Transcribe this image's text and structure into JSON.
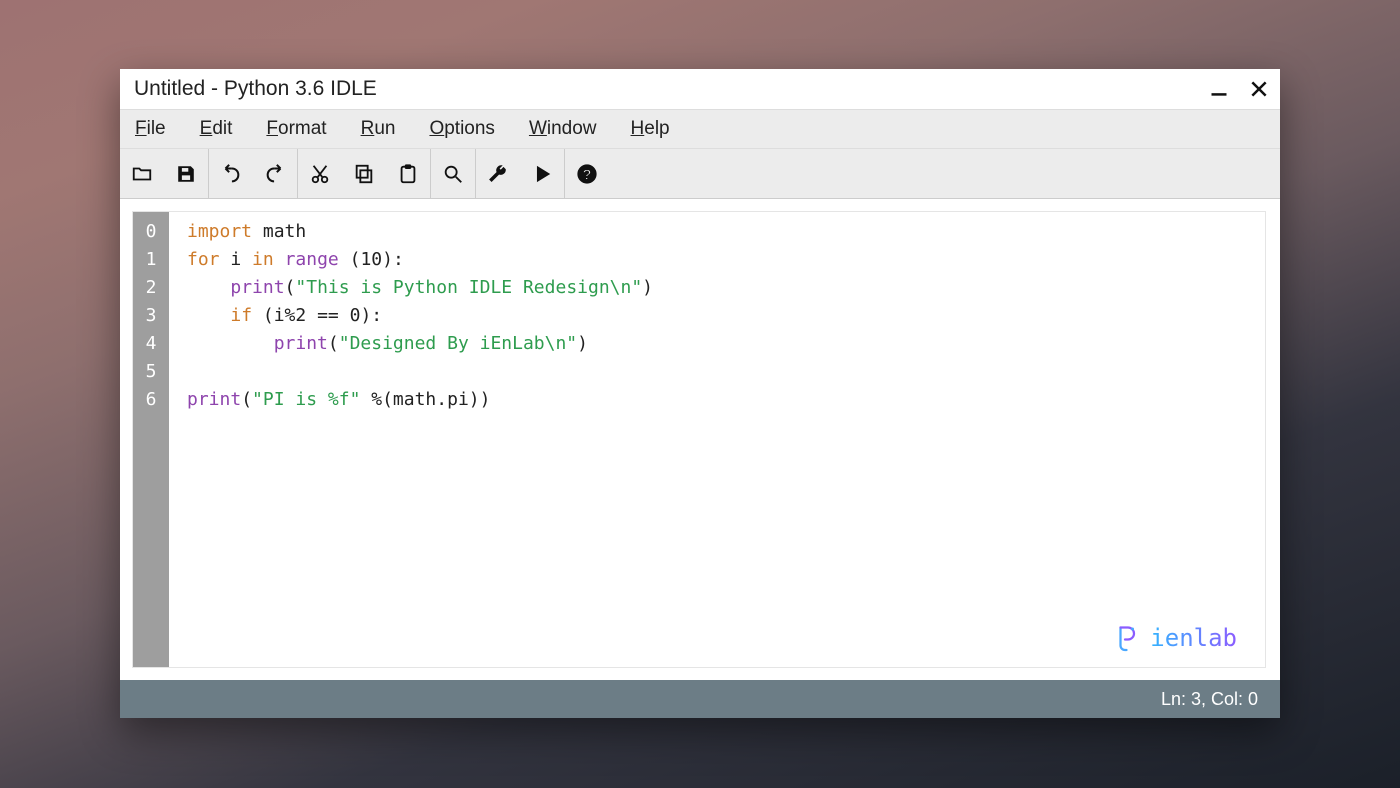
{
  "window": {
    "title": "Untitled - Python 3.6 IDLE"
  },
  "menubar": [
    {
      "label": "File",
      "u": "F",
      "rest": "ile"
    },
    {
      "label": "Edit",
      "u": "E",
      "rest": "dit"
    },
    {
      "label": "Format",
      "u": "F",
      "rest": "ormat"
    },
    {
      "label": "Run",
      "u": "R",
      "rest": "un"
    },
    {
      "label": "Options",
      "u": "O",
      "rest": "ptions"
    },
    {
      "label": "Window",
      "u": "W",
      "rest": "indow"
    },
    {
      "label": "Help",
      "u": "H",
      "rest": "elp"
    }
  ],
  "toolbar_groups": [
    [
      "open",
      "save"
    ],
    [
      "undo",
      "redo"
    ],
    [
      "cut",
      "copy",
      "paste"
    ],
    [
      "search"
    ],
    [
      "settings",
      "run"
    ],
    [
      "help"
    ]
  ],
  "code": {
    "line_numbers": [
      "0",
      "1",
      "2",
      "3",
      "4",
      "5",
      "6"
    ],
    "lines": [
      [
        {
          "t": "import ",
          "c": "kw"
        },
        {
          "t": "math",
          "c": ""
        }
      ],
      [
        {
          "t": "for ",
          "c": "kw"
        },
        {
          "t": "i ",
          "c": ""
        },
        {
          "t": "in ",
          "c": "kw"
        },
        {
          "t": "range ",
          "c": "bi"
        },
        {
          "t": "(",
          "c": ""
        },
        {
          "t": "10",
          "c": "num"
        },
        {
          "t": "):",
          "c": ""
        }
      ],
      [
        {
          "t": "    ",
          "c": ""
        },
        {
          "t": "print",
          "c": "bi"
        },
        {
          "t": "(",
          "c": ""
        },
        {
          "t": "\"This is Python IDLE Redesign\\n\"",
          "c": "str"
        },
        {
          "t": ")",
          "c": ""
        }
      ],
      [
        {
          "t": "    ",
          "c": ""
        },
        {
          "t": "if ",
          "c": "kw"
        },
        {
          "t": "(i%",
          "c": ""
        },
        {
          "t": "2",
          "c": "num"
        },
        {
          "t": " == ",
          "c": ""
        },
        {
          "t": "0",
          "c": "num"
        },
        {
          "t": "):",
          "c": ""
        }
      ],
      [
        {
          "t": "        ",
          "c": ""
        },
        {
          "t": "print",
          "c": "bi"
        },
        {
          "t": "(",
          "c": ""
        },
        {
          "t": "\"Designed By iEnLab\\n\"",
          "c": "str"
        },
        {
          "t": ")",
          "c": ""
        }
      ],
      [],
      [
        {
          "t": "print",
          "c": "bi"
        },
        {
          "t": "(",
          "c": ""
        },
        {
          "t": "\"PI is %f\"",
          "c": "str"
        },
        {
          "t": " %(math.pi))",
          "c": ""
        }
      ]
    ]
  },
  "logo": {
    "text": "ienlab"
  },
  "status": {
    "text": "Ln: 3, Col: 0"
  }
}
